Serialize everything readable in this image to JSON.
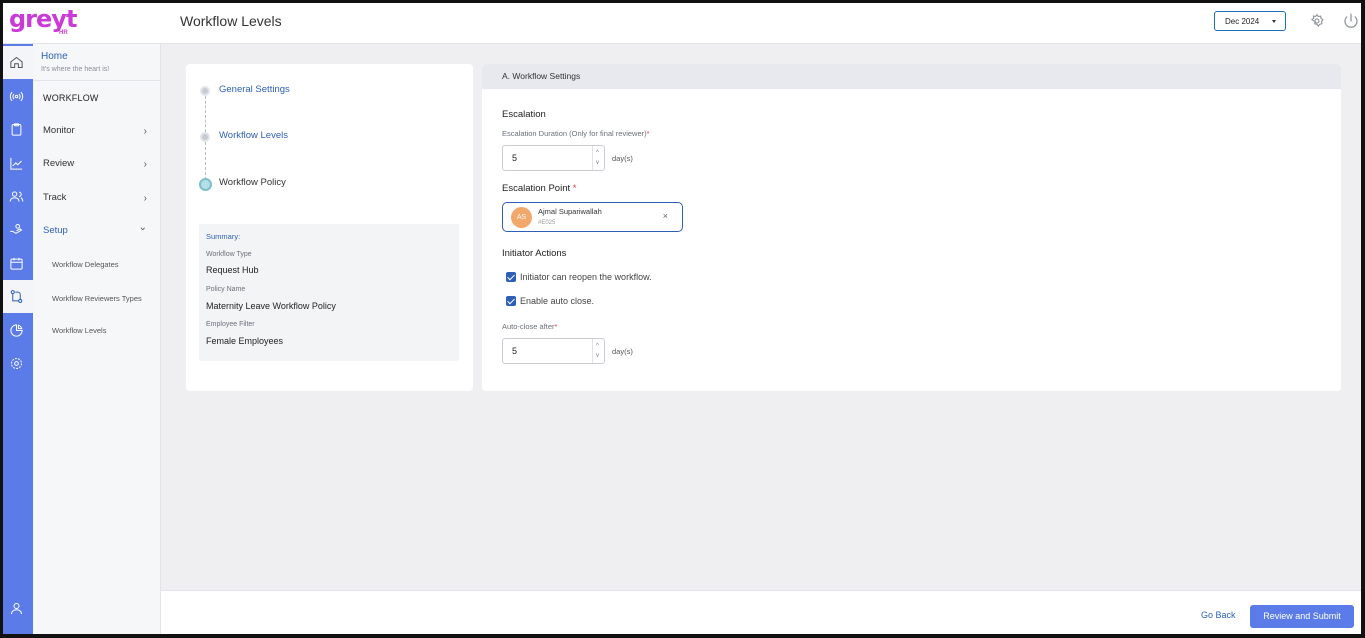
{
  "header": {
    "logo_text": "greyt",
    "logo_sub": "HR",
    "title": "Workflow Levels",
    "period": "Dec 2024"
  },
  "icons": {
    "rail": [
      "home-icon",
      "broadcast-icon",
      "clipboard-icon",
      "chart-icon",
      "users-icon",
      "hand-icon",
      "calendar-icon",
      "workflow-icon",
      "pie-chart-icon",
      "settings-icon",
      "profile-icon"
    ],
    "header": [
      "gear-icon",
      "power-icon"
    ]
  },
  "colors": {
    "brand": "#c93ad6",
    "accent": "#5b7ce8",
    "link": "#2e5fb8",
    "required": "#e03c3c",
    "avatar": "#f2a86a"
  },
  "subnav": {
    "home_title": "Home",
    "home_sub": "It's where the heart is!",
    "section": "WORKFLOW",
    "items": [
      {
        "label": "Monitor",
        "chevron": "›"
      },
      {
        "label": "Review",
        "chevron": "›"
      },
      {
        "label": "Track",
        "chevron": "›"
      },
      {
        "label": "Setup",
        "chevron": "⌄"
      }
    ],
    "setup_items": [
      "Workflow Delegates",
      "Workflow Reviewers Types",
      "Workflow Levels"
    ]
  },
  "steps": {
    "items": [
      "General Settings",
      "Workflow Levels",
      "Workflow Policy"
    ],
    "current": "Workflow Policy"
  },
  "summary": {
    "title": "Summary:",
    "workflow_type_label": "Workflow Type",
    "workflow_type": "Request Hub",
    "policy_name_label": "Policy Name",
    "policy_name": "Maternity Leave Workflow Policy",
    "employee_filter_label": "Employee Filter",
    "employee_filter": "Female Employees"
  },
  "settings": {
    "header": "A. Workflow Settings",
    "escalation_title": "Escalation",
    "duration_label": "Escalation Duration (Only for final reviewer)",
    "duration_value": "5",
    "unit": "day(s)",
    "point_label": "Escalation Point",
    "required_mark": "*",
    "reviewer": {
      "initials": "AS",
      "name": "Ajmal Supariwallah",
      "id": "#E025",
      "remove": "×"
    },
    "initiator_title": "Initiator Actions",
    "checkboxes": [
      {
        "label": "Initiator can reopen the workflow.",
        "checked": true
      },
      {
        "label": "Enable auto close.",
        "checked": true
      }
    ],
    "autoclose_label": "Auto-close after",
    "autoclose_value": "5",
    "spin_up": "^",
    "spin_down": "v"
  },
  "footer": {
    "back": "Go Back",
    "submit": "Review and Submit"
  }
}
